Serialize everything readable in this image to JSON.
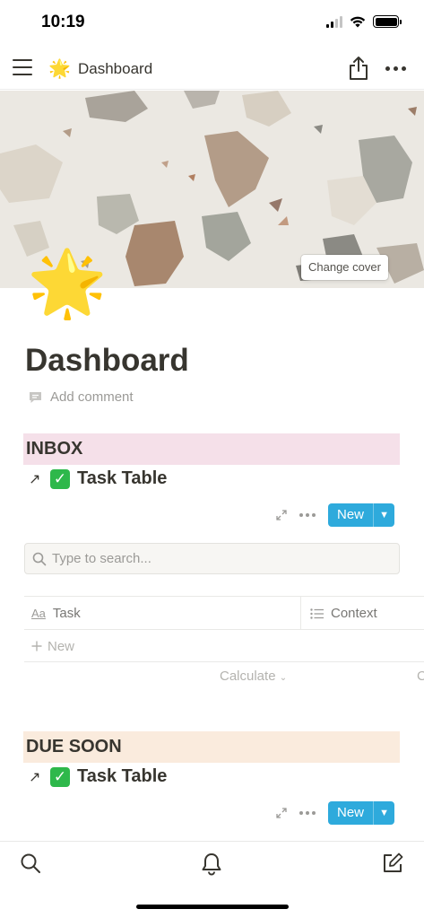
{
  "status_bar": {
    "time": "10:19"
  },
  "nav": {
    "emoji": "🌟",
    "title": "Dashboard"
  },
  "cover": {
    "change_cover_label": "Change cover"
  },
  "page": {
    "icon": "🌟",
    "title": "Dashboard",
    "add_comment": "Add comment"
  },
  "sections": [
    {
      "header": "INBOX",
      "link_arrow": "↗",
      "link_emoji": "✓",
      "link_label": "Task Table",
      "new_button": "New"
    },
    {
      "header": "DUE SOON",
      "link_arrow": "↗",
      "link_emoji": "✓",
      "link_label": "Task Table",
      "new_button": "New"
    }
  ],
  "inbox_table": {
    "search_placeholder": "Type to search...",
    "columns": [
      {
        "icon": "Aa",
        "label": "Task"
      },
      {
        "icon": "list-icon",
        "label": "Context"
      }
    ],
    "new_row_label": "New",
    "calculate_label": "Calculate",
    "calculate_clipped": "C"
  },
  "colors": {
    "inbox_header_bg": "#f5e0e9",
    "due_soon_header_bg": "#faebdd",
    "new_button_bg": "#2eaadc",
    "check_bg": "#2eb84b"
  },
  "icons": [
    "menu-icon",
    "share-icon",
    "more-icon",
    "comment-icon",
    "expand-icon",
    "search-icon",
    "bell-icon",
    "compose-icon"
  ]
}
